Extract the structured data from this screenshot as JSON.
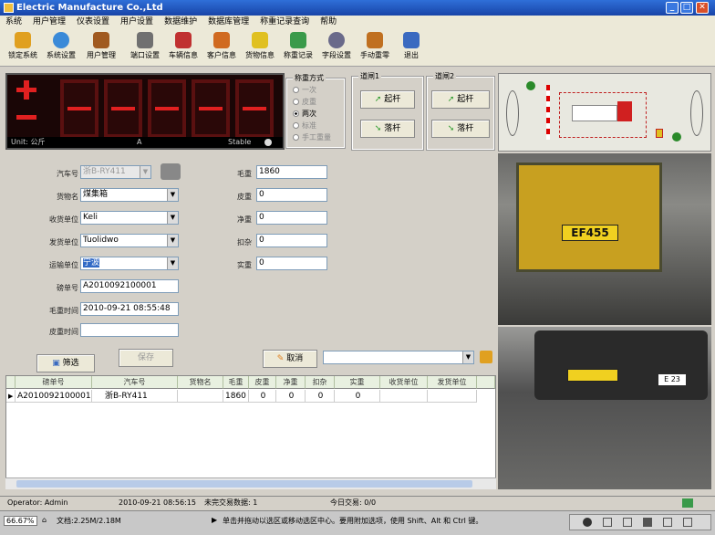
{
  "window": {
    "title": "Electric Manufacture Co.,Ltd"
  },
  "menu": [
    "系统",
    "用户管理",
    "仪表设置",
    "用户设置",
    "数据维护",
    "数据库管理",
    "称重记录查询",
    "帮助"
  ],
  "toolbar": [
    {
      "label": "锁定系统",
      "icon": "lock-icon",
      "color": "#e0a020"
    },
    {
      "label": "系统设置",
      "icon": "globe-settings-icon",
      "color": "#3a8ad8"
    },
    {
      "label": "用户管理",
      "icon": "users-icon",
      "color": "#a05a20"
    },
    {
      "label": "端口设置",
      "icon": "tools-icon",
      "color": "#707070"
    },
    {
      "label": "车辆信息",
      "icon": "truck-icon",
      "color": "#c03030"
    },
    {
      "label": "客户信息",
      "icon": "customer-icon",
      "color": "#d06a20"
    },
    {
      "label": "货物信息",
      "icon": "goods-icon",
      "color": "#e0c020"
    },
    {
      "label": "称重记录",
      "icon": "records-icon",
      "color": "#3a9a4a"
    },
    {
      "label": "字段设置",
      "icon": "search-icon",
      "color": "#6a6a8a"
    },
    {
      "label": "手动重零",
      "icon": "manual-zero-icon",
      "color": "#c07020"
    },
    {
      "label": "退出",
      "icon": "exit-icon",
      "color": "#3a6ac0"
    }
  ],
  "scale": {
    "unit_label": "Unit: 公斤",
    "mid": "A",
    "stable": "Stable"
  },
  "weigh_mode": {
    "title": "称重方式",
    "options": [
      "一次",
      "皮重",
      "两次",
      "标准",
      "手工重量"
    ],
    "selected": "两次"
  },
  "gate1": {
    "title": "道闸1",
    "raise": "起杆",
    "lower": "落杆"
  },
  "gate2": {
    "title": "道闸2",
    "raise": "起杆",
    "lower": "落杆"
  },
  "form": {
    "plate": {
      "label": "汽车号",
      "value": "浙B-RY411"
    },
    "goods": {
      "label": "货物名",
      "value": "煤集箱"
    },
    "receiver": {
      "label": "收货单位",
      "value": "Keli"
    },
    "shipper": {
      "label": "发货单位",
      "value": "Tuolidwo"
    },
    "carrier": {
      "label": "运输单位",
      "value": "宁波"
    },
    "ticket": {
      "label": "磅单号",
      "value": "A2010092100001"
    },
    "gross_time": {
      "label": "毛重时间",
      "value": "2010-09-21 08:55:48"
    },
    "tare_time": {
      "label": "皮重时间",
      "value": ""
    },
    "gross": {
      "label": "毛重",
      "value": "1860"
    },
    "tare": {
      "label": "皮重",
      "value": "0"
    },
    "net": {
      "label": "净重",
      "value": "0"
    },
    "deduct": {
      "label": "扣杂",
      "value": "0"
    },
    "actual": {
      "label": "实重",
      "value": "0"
    }
  },
  "buttons": {
    "filter": "筛选",
    "save": "保存",
    "cancel": "取消"
  },
  "grid": {
    "headers": [
      "磅单号",
      "汽车号",
      "货物名",
      "毛重",
      "皮重",
      "净重",
      "扣杂",
      "实重",
      "收货单位",
      "发货单位"
    ],
    "rows": [
      [
        "A2010092100001",
        "浙B-RY411",
        "",
        "1860",
        "0",
        "0",
        "0",
        "0",
        "",
        ""
      ]
    ]
  },
  "status": {
    "operator": "Operator: Admin",
    "time": "2010-09-21 08:56:15",
    "unfinished": "未完交易数据: 1",
    "today": "今日交易: 0/0"
  },
  "bottom": {
    "zoom": "66.67%",
    "doc": "文档:2.25M/2.18M",
    "hint": "单击并拖动以选区或移动选区中心。要用附加选项，使用 Shift、Alt 和 Ctrl 键。"
  },
  "photos": {
    "plate1": "EF455",
    "plate2": "E 23"
  }
}
